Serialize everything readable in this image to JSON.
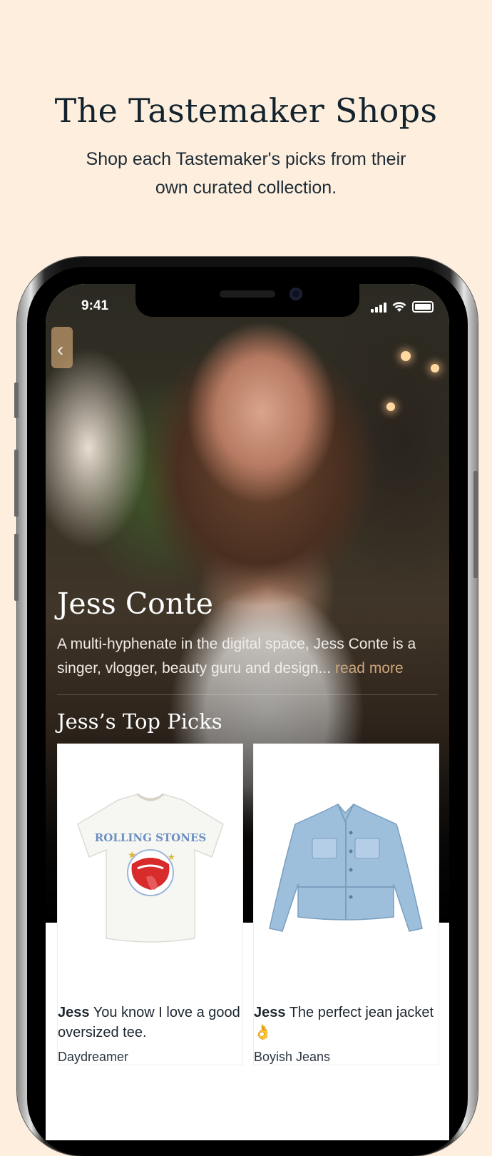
{
  "promo": {
    "headline": "The Tastemaker Shops",
    "subhead": "Shop each Tastemaker's picks from their own curated collection."
  },
  "status_bar": {
    "time": "9:41",
    "icons": [
      "cellular-signal-icon",
      "wifi-icon",
      "battery-icon"
    ]
  },
  "nav": {
    "back_icon": "chevron-left-icon",
    "back_glyph": "‹"
  },
  "profile": {
    "name": "Jess Conte",
    "bio": "A multi-hyphenate in the digital space, Jess Conte is a singer, vlogger, beauty guru and design...",
    "read_more": "read more"
  },
  "picks": {
    "title": "Jess’s Top Picks",
    "items": [
      {
        "author": "Jess",
        "blurb": "You know I love a good oversized tee.",
        "brand": "Daydreamer",
        "image": "rolling-stones-tee-image"
      },
      {
        "author": "Jess",
        "blurb": "The perfect jean jacket 👌",
        "brand": "Boyish Jeans",
        "image": "jean-jacket-image"
      }
    ]
  },
  "colors": {
    "background": "#fdeedd",
    "headline": "#13232e",
    "read_more": "#cfa77e"
  }
}
